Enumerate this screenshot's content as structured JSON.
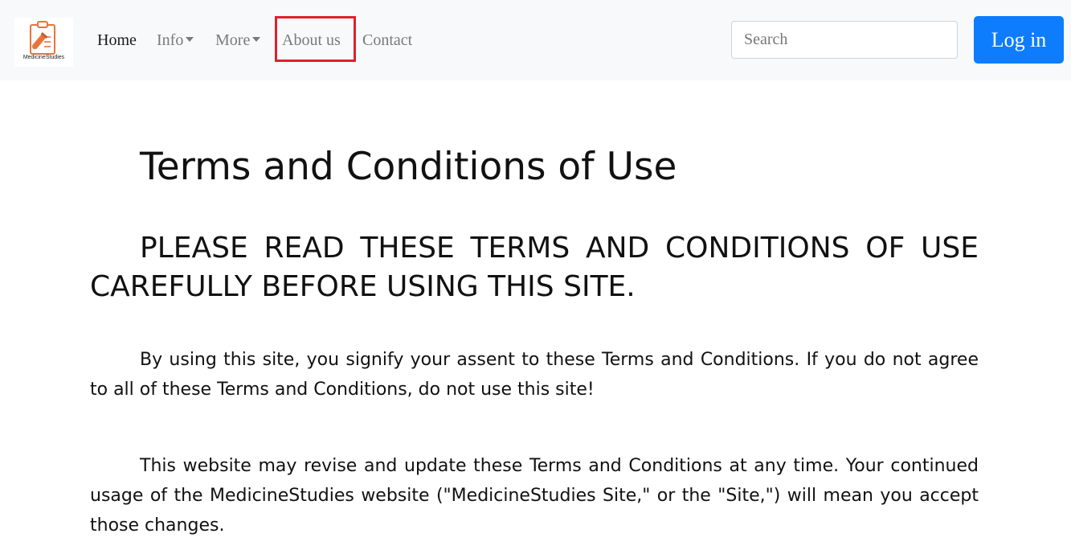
{
  "navbar": {
    "logo": {
      "text": "MedicineStudies",
      "icon": "clipboard-test-tube-logo",
      "accent_color": "#e8743b"
    },
    "links": [
      {
        "label": "Home",
        "active": true
      },
      {
        "label": "Info",
        "dropdown": true
      },
      {
        "label": "More",
        "dropdown": true
      },
      {
        "label": "About us",
        "highlighted": true,
        "highlight_color": "#e0202e"
      },
      {
        "label": "Contact"
      }
    ],
    "search": {
      "placeholder": "Search",
      "value": ""
    },
    "login_label": "Log in",
    "login_color": "#0d7dfd"
  },
  "page": {
    "title": "Terms and Conditions of Use",
    "warning": "PLEASE READ THESE TERMS AND CONDITIONS OF USE CAREFULLY BEFORE USING THIS SITE.",
    "paragraphs": [
      "By using this site, you signify your assent to these Terms and Conditions. If you do not agree to all of these Terms and Conditions, do not use this site!",
      "This website may revise and update these Terms and Conditions at any time. Your continued usage of the MedicineStudies website (\"MedicineStudies Site,\" or the \"Site,\") will mean you accept those changes."
    ]
  }
}
